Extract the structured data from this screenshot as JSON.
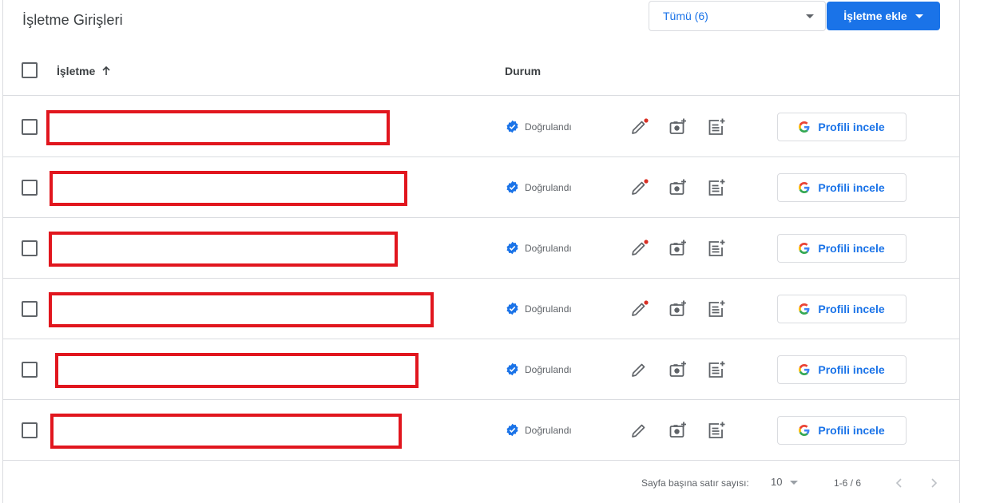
{
  "header": {
    "title": "İşletme Girişleri",
    "filter_label": "Tümü (6)",
    "add_button_label": "İşletme ekle"
  },
  "table": {
    "columns": {
      "name": "İşletme",
      "status": "Durum"
    },
    "rows": [
      {
        "status": "Doğrulandı",
        "profile_button": "Profili incele",
        "edit_has_alert": true
      },
      {
        "status": "Doğrulandı",
        "profile_button": "Profili incele",
        "edit_has_alert": true
      },
      {
        "status": "Doğrulandı",
        "profile_button": "Profili incele",
        "edit_has_alert": true
      },
      {
        "status": "Doğrulandı",
        "profile_button": "Profili incele",
        "edit_has_alert": true
      },
      {
        "status": "Doğrulandı",
        "profile_button": "Profili incele",
        "edit_has_alert": false
      },
      {
        "status": "Doğrulandı",
        "profile_button": "Profili incele",
        "edit_has_alert": false
      }
    ]
  },
  "footer": {
    "rows_per_page_label": "Sayfa başına satır sayısı:",
    "rows_per_page_value": "10",
    "range_label": "1-6 / 6"
  },
  "colors": {
    "accent": "#1a73e8",
    "verified": "#1a73e8",
    "alert_dot": "#d93025",
    "redaction": "#e1161e"
  },
  "icons": {
    "sort": "arrow-up-icon",
    "verified": "verified-badge-icon",
    "edit": "pencil-icon",
    "photo": "add-photo-icon",
    "post": "add-post-icon",
    "google": "google-g-icon",
    "prev": "chevron-left-icon",
    "next": "chevron-right-icon"
  }
}
